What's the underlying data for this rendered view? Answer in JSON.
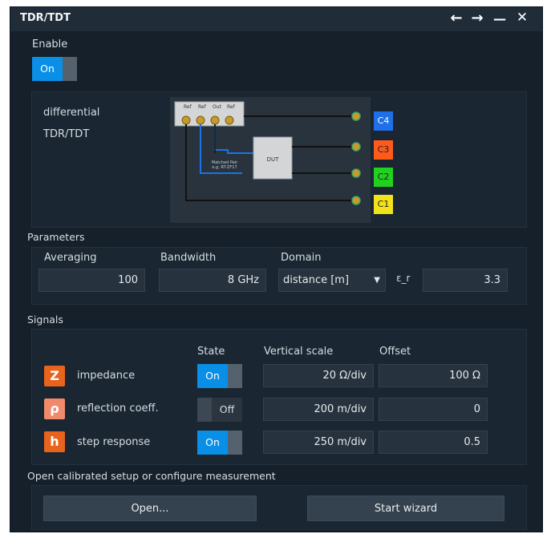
{
  "window": {
    "title": "TDR/TDT"
  },
  "titlebar": {
    "back_glyph": "←",
    "forward_glyph": "→",
    "minimize_glyph": "—",
    "close_glyph": "✕"
  },
  "enable": {
    "label": "Enable",
    "state": "On"
  },
  "setup": {
    "mode_line1": "differential",
    "mode_line2": "TDR/TDT",
    "channels": [
      "C4",
      "C3",
      "C2",
      "C1"
    ],
    "channel_colors": {
      "C4": "#1f6fe8",
      "C3": "#ff5a1a",
      "C2": "#22d11f",
      "C1": "#f1e21b"
    },
    "port_labels": [
      "Ref",
      "Ref",
      "Out",
      "Ref"
    ],
    "dut_label": "DUT",
    "cable_label_1": "Matched Pair",
    "cable_label_2": "e.g. RT-ZF17"
  },
  "parameters": {
    "section_label": "Parameters",
    "averaging": {
      "label": "Averaging",
      "value": "100"
    },
    "bandwidth": {
      "label": "Bandwidth",
      "value": "8 GHz"
    },
    "domain": {
      "label": "Domain",
      "value": "distance [m]"
    },
    "epsilon": {
      "label": "ε_r",
      "value": "3.3"
    }
  },
  "signals": {
    "section_label": "Signals",
    "headers": {
      "state": "State",
      "vertical_scale": "Vertical scale",
      "offset": "Offset"
    },
    "rows": [
      {
        "symbol": "Z",
        "name": "impedance",
        "state": "On",
        "scale": "20 Ω/div",
        "offset": "100 Ω",
        "color": "#e8631c"
      },
      {
        "symbol": "ρ",
        "name": "reflection coeff.",
        "state": "Off",
        "scale": "200 m/div",
        "offset": "0",
        "color": "#f08a6a"
      },
      {
        "symbol": "h",
        "name": "step response",
        "state": "On",
        "scale": "250 m/div",
        "offset": "0.5",
        "color": "#e8631c"
      }
    ]
  },
  "footer": {
    "label": "Open calibrated setup or configure measurement",
    "open_button": "Open...",
    "wizard_button": "Start wizard"
  }
}
